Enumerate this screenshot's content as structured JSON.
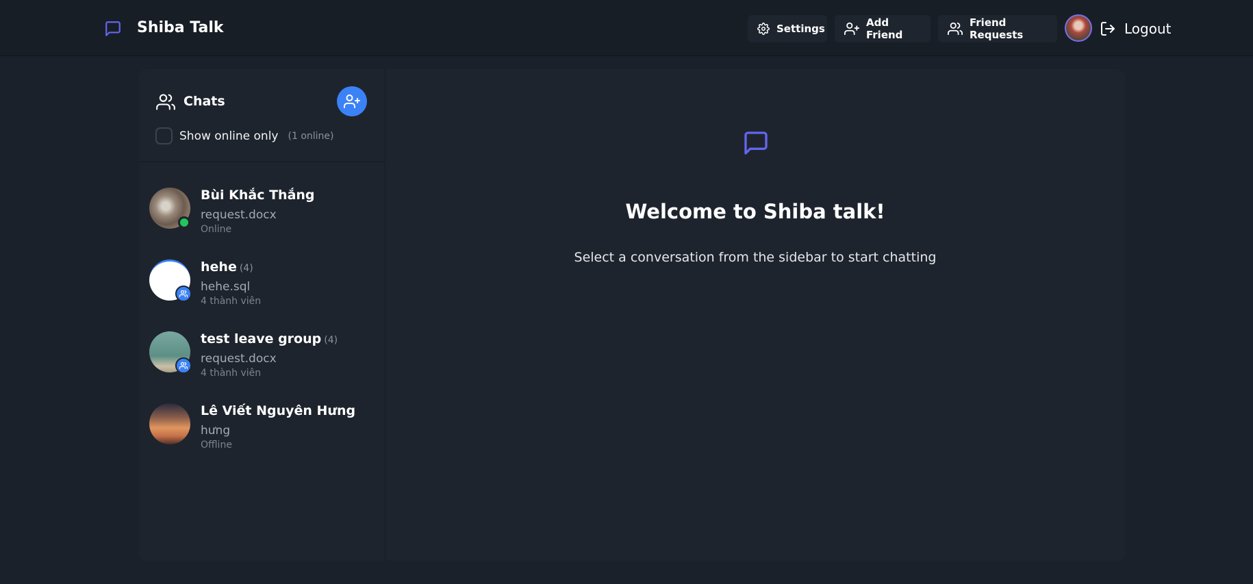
{
  "header": {
    "brand": "Shiba Talk",
    "settings_label": "Settings",
    "add_friend_label": "Add Friend",
    "friend_requests_label": "Friend Requests",
    "logout_label": "Logout"
  },
  "sidebar": {
    "title": "Chats",
    "online_filter_label": "Show online only",
    "online_count": "(1 online)",
    "chats": [
      {
        "name": "Bùi Khắc Thắng",
        "count": "",
        "last_message": "request.docx",
        "status": "Online",
        "type": "direct",
        "online": true
      },
      {
        "name": "hehe",
        "count": "(4)",
        "last_message": "hehe.sql",
        "status": "4 thành viên",
        "type": "group"
      },
      {
        "name": "test leave group",
        "count": "(4)",
        "last_message": "request.docx",
        "status": "4 thành viên",
        "type": "group"
      },
      {
        "name": "Lê Viết Nguyên Hưng",
        "count": "",
        "last_message": "hưng",
        "status": "Offline",
        "type": "direct",
        "online": false
      }
    ]
  },
  "main": {
    "welcome_title": "Welcome to Shiba talk!",
    "welcome_subtitle": "Select a conversation from the sidebar to start chatting"
  },
  "icons": {
    "brand": "message-square-icon",
    "settings": "gear-icon",
    "add_friend": "user-plus-icon",
    "friend_requests": "users-icon",
    "logout": "log-out-icon"
  },
  "colors": {
    "accent": "#3b82f6",
    "brand_icon": "#6366f1",
    "online": "#22c55e",
    "background": "#1b212a",
    "panel": "#1e242d"
  }
}
